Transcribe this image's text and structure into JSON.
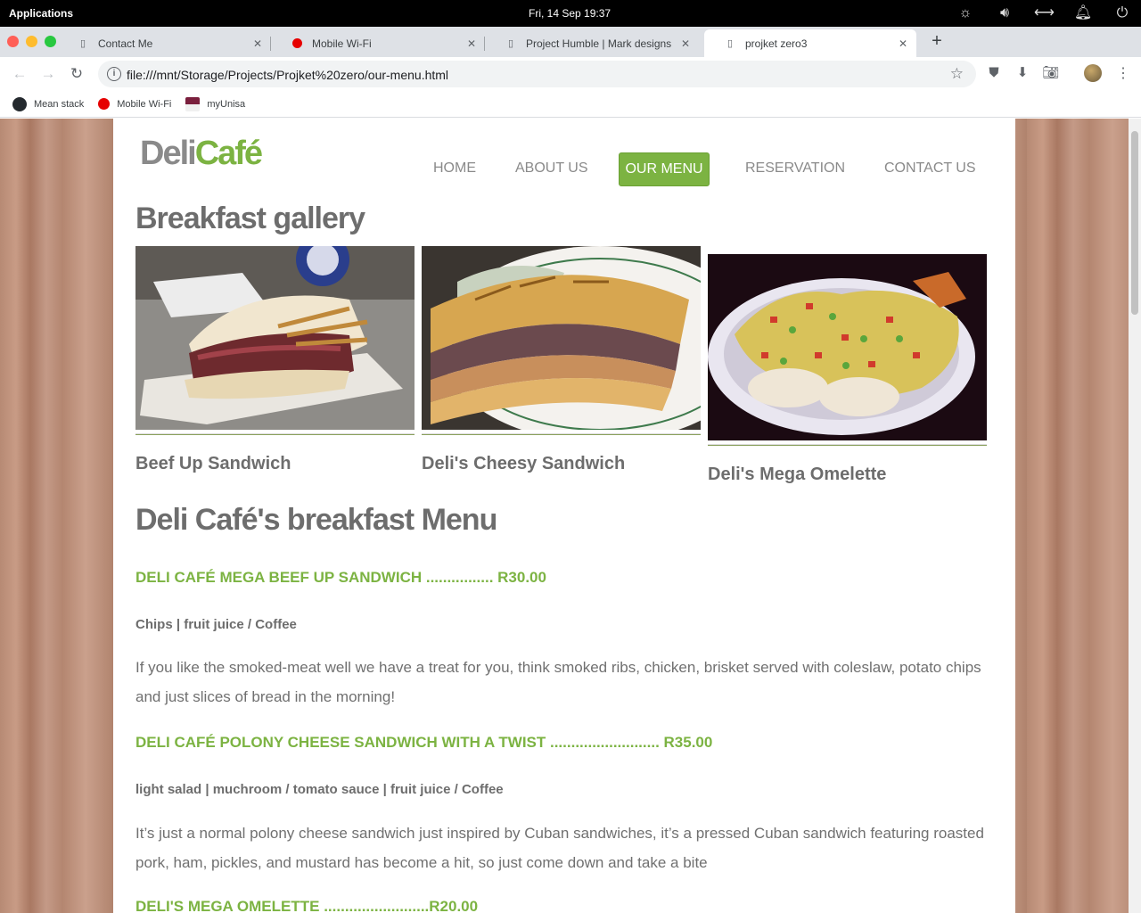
{
  "system": {
    "apps_label": "Applications",
    "datetime": "Fri, 14 Sep    19:37"
  },
  "tabs": [
    {
      "label": "Contact Me",
      "active": false
    },
    {
      "label": "Mobile Wi-Fi",
      "active": false
    },
    {
      "label": "Project Humble | Mark designs",
      "active": false
    },
    {
      "label": "projket zero3",
      "active": true
    }
  ],
  "address": {
    "url": "file:///mnt/Storage/Projects/Projket%20zero/our-menu.html"
  },
  "bookmarks": [
    {
      "label": "Mean stack"
    },
    {
      "label": "Mobile Wi-Fi"
    },
    {
      "label": "myUnisa"
    }
  ],
  "site": {
    "logo_part1": "Deli",
    "logo_part2": "Café",
    "accent_color": "#7cb342",
    "nav": {
      "home": "HOME",
      "about": "ABOUT US",
      "menu": "OUR MENU",
      "reservation": "RESERVATION",
      "contact": "CONTACT US"
    },
    "gallery_title": "Breakfast gallery",
    "gallery": [
      {
        "caption": "Beef Up Sandwich"
      },
      {
        "caption": "Deli's Cheesy Sandwich"
      },
      {
        "caption": "Deli's Mega Omelette"
      }
    ],
    "menu_title": "Deli Café's breakfast Menu",
    "items": [
      {
        "name": "DELI CAFÉ MEGA BEEF UP SANDWICH ................ R30.00",
        "extras": "Chips | fruit juice / Coffee",
        "description": "If you like the smoked-meat well we have a treat for you, think smoked ribs, chicken, brisket served with coleslaw, potato chips and just slices of bread in the morning!"
      },
      {
        "name": "DELI CAFÉ POLONY CHEESE SANDWICH WITH A TWIST .......................... R35.00",
        "extras": "light salad | muchroom / tomato sauce | fruit juice / Coffee",
        "description": "It’s just a normal polony cheese sandwich just inspired by Cuban sandwiches, it’s a pressed Cuban sandwich featuring roasted pork, ham, pickles, and mustard has become a hit, so just come down and take a bite"
      },
      {
        "name": "DELI'S MEGA OMELETTE .........................R20.00"
      }
    ]
  }
}
